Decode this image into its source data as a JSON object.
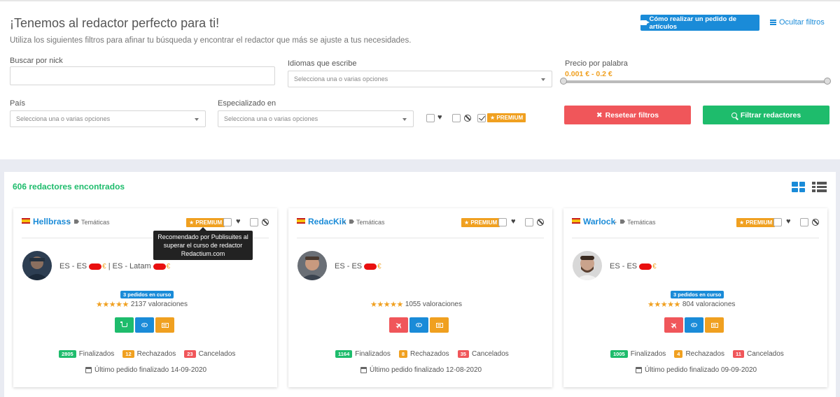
{
  "header": {
    "title": "¡Tenemos al redactor perfecto para ti!",
    "subtitle": "Utiliza los siguientes filtros para afinar tu búsqueda y encontrar el redactor que más se ajuste a tus necesidades.",
    "video_button": "Cómo realizar un pedido de artículos",
    "hide_filters": "Ocultar filtros"
  },
  "filters": {
    "nick_label": "Buscar por nick",
    "nick_value": "",
    "languages_label": "Idiomas que escribe",
    "languages_placeholder": "Selecciona una o varias opciones",
    "price_label": "Precio por palabra",
    "price_range": "0.001 € - 0.2 €",
    "country_label": "País",
    "country_placeholder": "Selecciona una o varias opciones",
    "specialized_label": "Especializado en",
    "specialized_placeholder": "Selecciona una o varias opciones",
    "premium_label": "PREMIUM",
    "reset_button": "Resetear filtros",
    "search_button": "Filtrar redactores"
  },
  "results": {
    "count_label": "606 redactores encontrados"
  },
  "tooltip": {
    "text": "Recomendado por Publisuites al superar el curso de redactor Redactium.com"
  },
  "cards": [
    {
      "nick": "Hellbrass",
      "dash": "-",
      "tematicas": "Temáticas",
      "premium": "PREMIUM",
      "lang_1": "ES - ES",
      "lang_sep": "| ES - Latam",
      "euro": "€",
      "pending": "3 pedidos en curso",
      "stars": "★★★★★",
      "ratings": "2137 valoraciones",
      "finalized_num": "2805",
      "finalized_label": "Finalizados",
      "rejected_num": "12",
      "rejected_label": "Rechazados",
      "cancelled_num": "23",
      "cancelled_label": "Cancelados",
      "last_order": "Último pedido finalizado 14-09-2020"
    },
    {
      "nick": "RedacKik",
      "dash": "-",
      "tematicas": "Temáticas",
      "premium": "PREMIUM",
      "lang_1": "ES - ES",
      "euro": "€",
      "stars": "★★★★★",
      "ratings": "1055 valoraciones",
      "finalized_num": "1164",
      "finalized_label": "Finalizados",
      "rejected_num": "8",
      "rejected_label": "Rechazados",
      "cancelled_num": "35",
      "cancelled_label": "Cancelados",
      "last_order": "Último pedido finalizado 12-08-2020"
    },
    {
      "nick": "Warlock",
      "dash": "-",
      "tematicas": "Temáticas",
      "premium": "PREMIUM",
      "lang_1": "ES - ES",
      "euro": "€",
      "pending": "3 pedidos en curso",
      "stars": "★★★★★",
      "ratings": "804 valoraciones",
      "finalized_num": "1005",
      "finalized_label": "Finalizados",
      "rejected_num": "4",
      "rejected_label": "Rechazados",
      "cancelled_num": "11",
      "cancelled_label": "Cancelados",
      "last_order": "Último pedido finalizado 09-09-2020"
    }
  ],
  "colors": {
    "blue": "#1a8bd8",
    "green": "#1ebc6c",
    "red": "#f0565a",
    "orange": "#f0a020"
  }
}
